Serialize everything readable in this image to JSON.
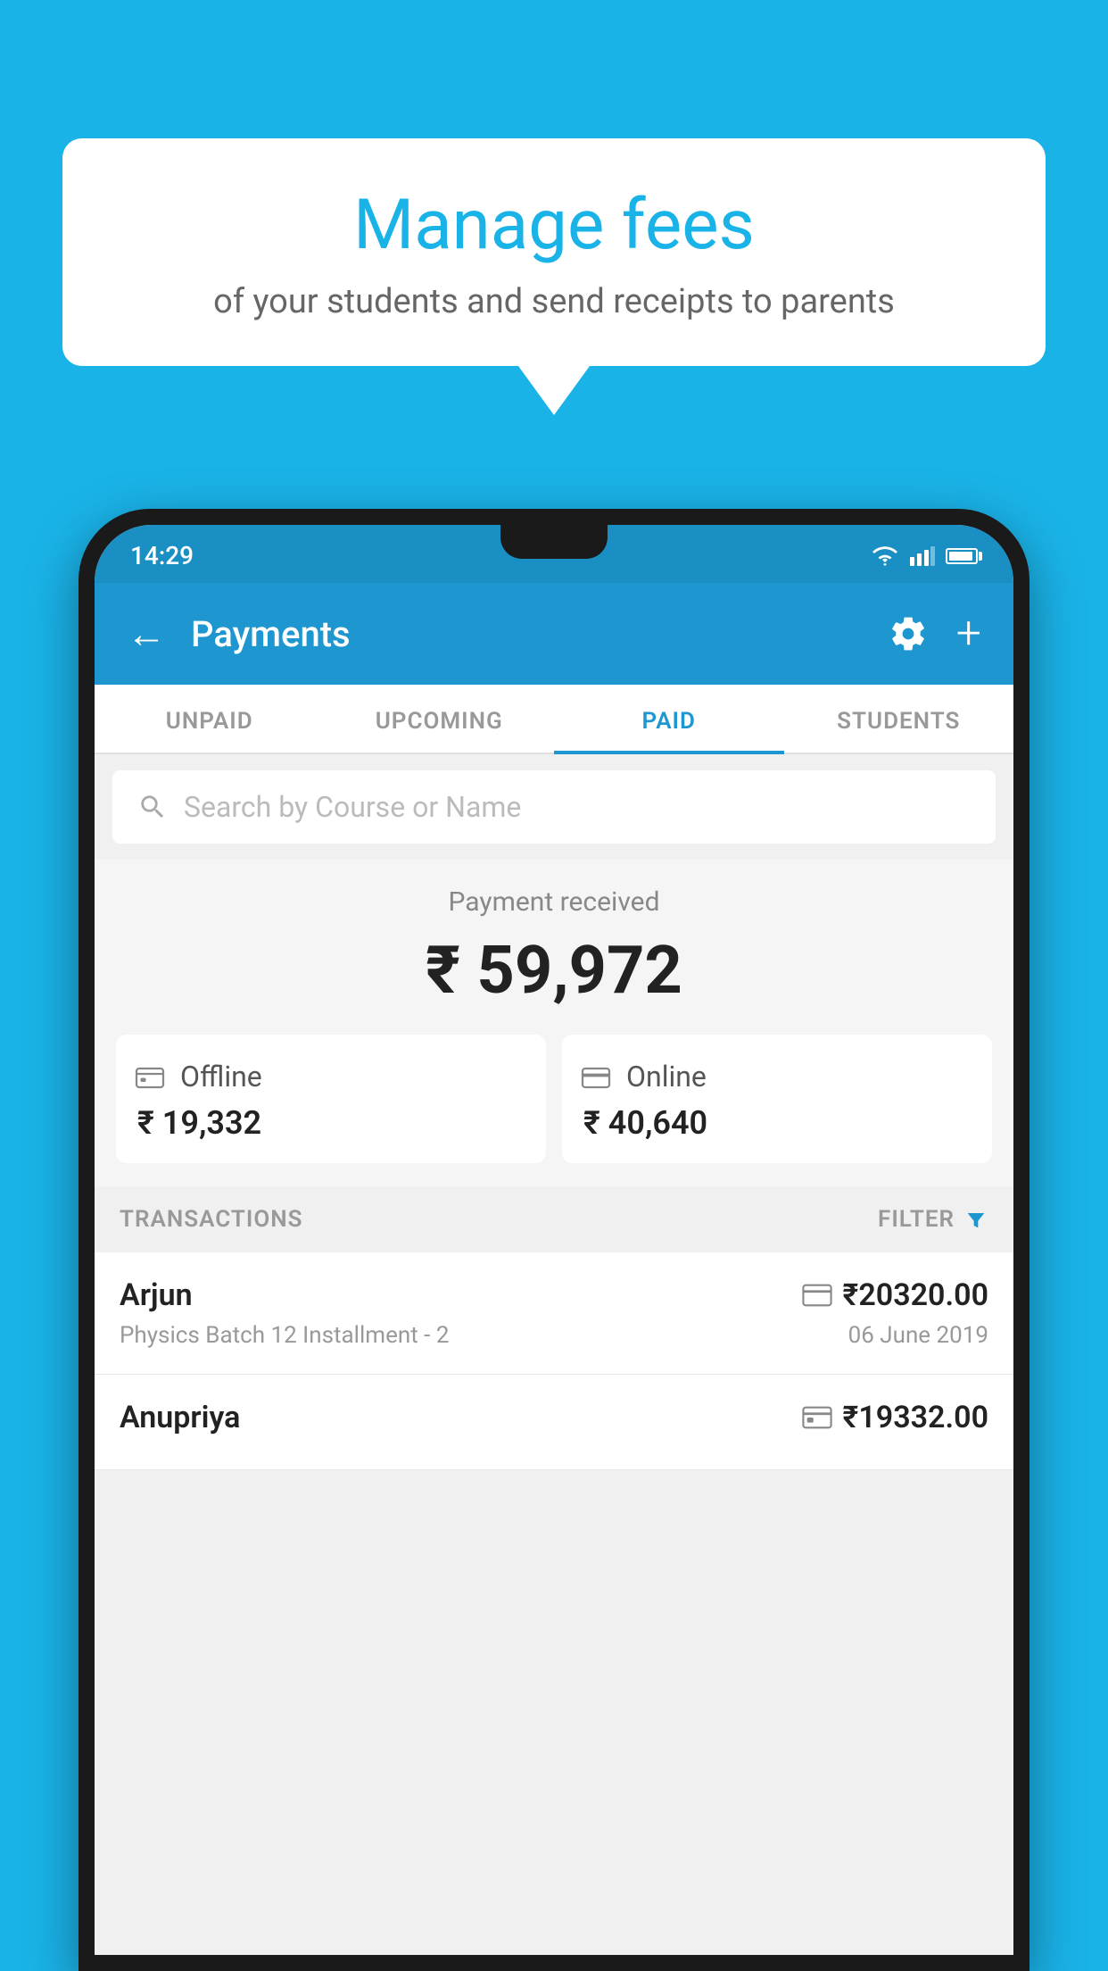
{
  "page": {
    "background_color": "#1ab3e8"
  },
  "bubble": {
    "title": "Manage fees",
    "subtitle": "of your students and send receipts to parents"
  },
  "status_bar": {
    "time": "14:29",
    "wifi_icon": "▾",
    "signal_icon": "▲"
  },
  "header": {
    "back_label": "←",
    "title": "Payments",
    "settings_icon": "⚙",
    "add_icon": "+"
  },
  "tabs": [
    {
      "label": "UNPAID",
      "active": false
    },
    {
      "label": "UPCOMING",
      "active": false
    },
    {
      "label": "PAID",
      "active": true
    },
    {
      "label": "STUDENTS",
      "active": false
    }
  ],
  "search": {
    "placeholder": "Search by Course or Name"
  },
  "payment_summary": {
    "label": "Payment received",
    "total": "₹ 59,972",
    "offline": {
      "label": "Offline",
      "amount": "₹ 19,332"
    },
    "online": {
      "label": "Online",
      "amount": "₹ 40,640"
    }
  },
  "transactions": {
    "header_label": "TRANSACTIONS",
    "filter_label": "FILTER",
    "items": [
      {
        "name": "Arjun",
        "description": "Physics Batch 12 Installment - 2",
        "amount": "₹20320.00",
        "date": "06 June 2019",
        "type": "online"
      },
      {
        "name": "Anupriya",
        "description": "",
        "amount": "₹19332.00",
        "date": "",
        "type": "offline"
      }
    ]
  }
}
